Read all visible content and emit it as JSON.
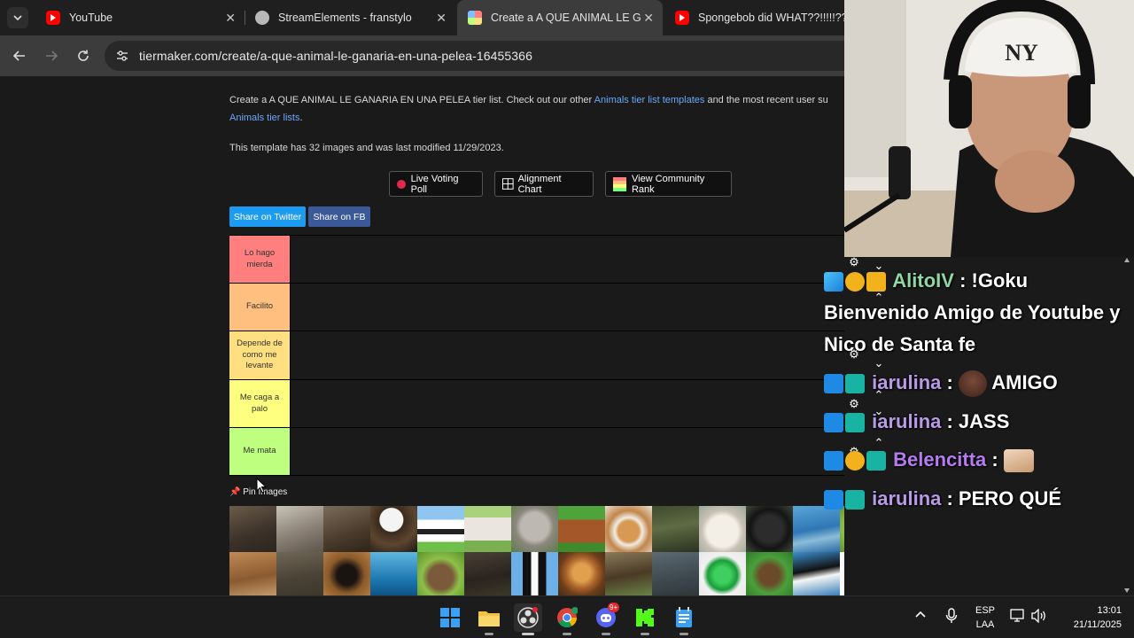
{
  "browser": {
    "tabs": [
      {
        "title": "YouTube",
        "favicon_color": "#ff0000",
        "active": false
      },
      {
        "title": "StreamElements - franstylo",
        "favicon_color": "#b8b8b8",
        "active": false
      },
      {
        "title": "Create a A QUE ANIMAL LE GANA",
        "favicon_color": "#e8e8e8",
        "active": true
      },
      {
        "title": "Spongebob did WHAT??!!!!!??",
        "favicon_color": "#ff0000",
        "active": false
      }
    ],
    "close_glyph": "✕",
    "url": "tiermaker.com/create/a-que-animal-le-ganaria-en-una-pelea-16455366"
  },
  "page": {
    "intro_part1": "Create a A QUE ANIMAL LE GANARIA EN UNA PELEA tier list. Check out our other ",
    "intro_link1": "Animals tier list templates",
    "intro_part2": " and the most recent user su",
    "intro_link2": "Animals tier lists",
    "intro_end": ".",
    "template_info": "This template has 32 images and was last modified 11/29/2023.",
    "buttons": {
      "live_voting": "Live Voting Poll",
      "alignment_chart": "Alignment Chart",
      "community_rank": "View Community Rank"
    },
    "share": {
      "twitter": "Share on Twitter",
      "fb": "Share on FB"
    },
    "tiers": [
      {
        "label": "Lo hago mierda",
        "color": "#ff7f7f"
      },
      {
        "label": "Facilito",
        "color": "#ffbf7f"
      },
      {
        "label": "Depende de como me levante",
        "color": "#ffdf7f"
      },
      {
        "label": "Me caga a palo",
        "color": "#ffff7f"
      },
      {
        "label": "Me mata",
        "color": "#bfff7f"
      }
    ],
    "pin_images": "Pin Images",
    "animal_images_row1": [
      "otter",
      "wolf",
      "donkey",
      "eagle",
      "cow",
      "goat",
      "koala",
      "chicken",
      "guinea-pig",
      "crocodile",
      "sheep",
      "gorilla",
      "dolphin",
      "squirrel"
    ],
    "animal_images_row2": [
      "kangaroo",
      "hippo",
      "scorpion",
      "shark",
      "capybara",
      "boar",
      "penguin",
      "lion",
      "moose",
      "elephant",
      "snake",
      "otter-2",
      "orca",
      "panda"
    ]
  },
  "chat": {
    "messages": [
      {
        "user": "AlitoIV",
        "user_color": "#8fd7a3",
        "text": " : !Goku",
        "continuation": [
          "Bienvenido Amigo de Youtube y",
          "Nico de Santa fe"
        ]
      },
      {
        "user": "iarulina",
        "user_color": "#b89ae6",
        "text": " : ",
        "emote": true,
        "after_emote": " AMIGO"
      },
      {
        "user": "iarulina",
        "user_color": "#b89ae6",
        "text": " : JASS"
      },
      {
        "user": "Belencitta",
        "user_color": "#b57cf0",
        "text": " : ",
        "emote": true
      },
      {
        "user": "iarulina",
        "user_color": "#b89ae6",
        "text": " : PERO QUÉ"
      }
    ]
  },
  "taskbar": {
    "apps": [
      "windows-start",
      "file-explorer",
      "obs-studio",
      "chrome",
      "discord",
      "kick",
      "notepad"
    ],
    "discord_badge": "9+",
    "language_line1": "ESP",
    "language_line2": "LAA",
    "time": "13:01",
    "date": "21/11/2025"
  }
}
